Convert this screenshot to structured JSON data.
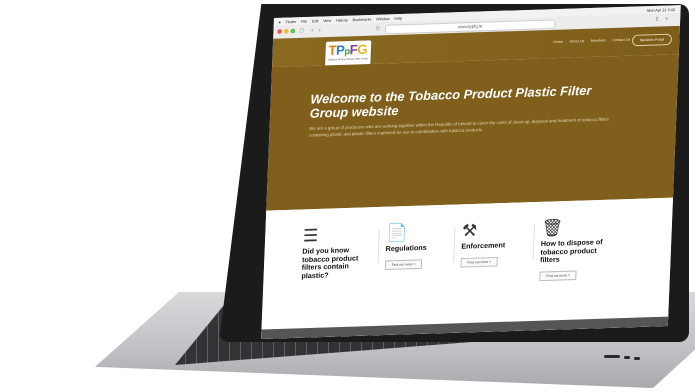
{
  "menubar": {
    "apple": "",
    "items": [
      "Finder",
      "File",
      "Edit",
      "View",
      "History",
      "Bookmarks",
      "Window",
      "Help"
    ],
    "clock": "Mon Apr 21 3:42"
  },
  "browser": {
    "url": "www.tppfg.ie"
  },
  "site": {
    "logo_text": "TPpFG",
    "logo_sub": "Tobacco Product Plastic Filter Group",
    "nav": [
      "Home",
      "About Us",
      "Members",
      "Contact Us"
    ],
    "nav_button": "Members Portal"
  },
  "hero": {
    "title": "Welcome to the Tobacco Product Plastic Filter Group website",
    "text": "We are a group of producers who are working together within the Republic of Ireland to cover the costs of clean-up, disposal and treatment of tobacco filters containing plastic and plastic filters marketed for use in combination with tobacco products."
  },
  "cards": [
    {
      "icon": "layers-icon",
      "title": "Did you know tobacco product filters contain plastic?",
      "button": ""
    },
    {
      "icon": "document-search-icon",
      "title": "Regulations",
      "button": "Find out more >"
    },
    {
      "icon": "gavel-icon",
      "title": "Enforcement",
      "button": "Find out more >"
    },
    {
      "icon": "bin-icon",
      "title": "How to dispose of tobacco product filters",
      "button": "Find out more >"
    }
  ],
  "colors": {
    "hero_brown": "#7f5f1b",
    "logo_t": "#e07b1a",
    "logo_p1": "#2a7fc1",
    "logo_p2": "#3aa546",
    "logo_f": "#7a3e9d",
    "logo_g": "#e3b51f"
  }
}
